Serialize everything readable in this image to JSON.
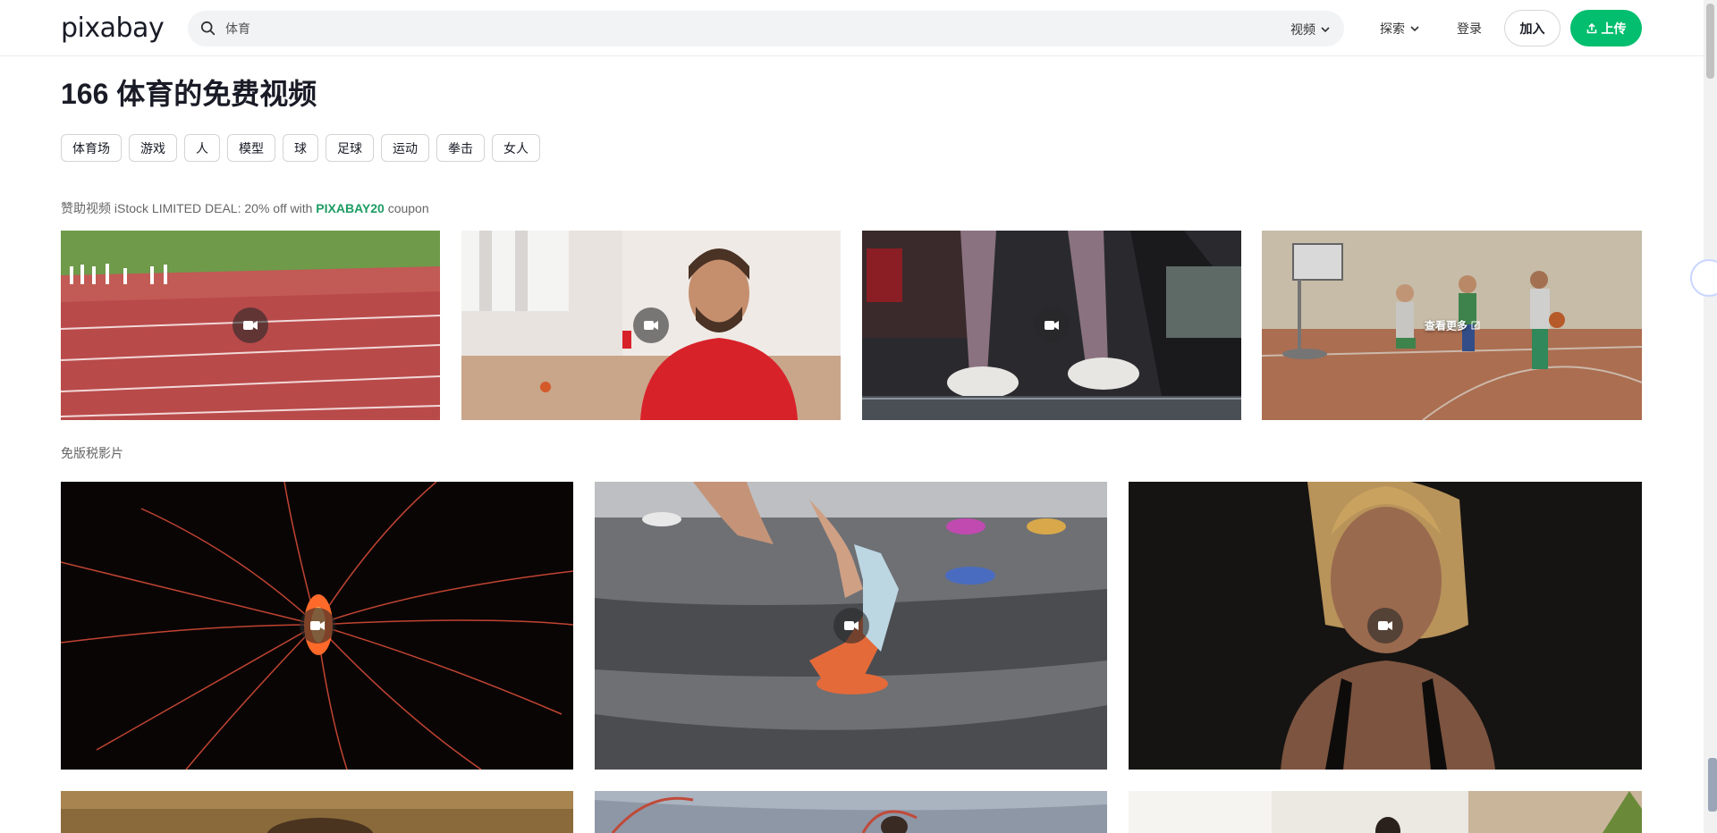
{
  "header": {
    "logo": "pixabay",
    "search_value": "体育",
    "type_select": "视频",
    "explore": "探索",
    "login": "登录",
    "join": "加入",
    "upload": "上传"
  },
  "page_title": "166 体育的免费视频",
  "tags": [
    "体育场",
    "游戏",
    "人",
    "模型",
    "球",
    "足球",
    "运动",
    "拳击",
    "女人"
  ],
  "sponsor": {
    "prefix": "赞助视频 iStock LIMITED DEAL: 20% off with ",
    "code": "PIXABAY20",
    "suffix": " coupon"
  },
  "free_label": "免版税影片",
  "see_more": "查看更多",
  "icons": {
    "search": "search-icon",
    "chevron": "chevron-down-icon",
    "upload": "upload-icon",
    "video": "video-camera-icon",
    "external": "external-link-icon"
  },
  "colors": {
    "accent": "#02be6e",
    "coupon": "#1c9c63"
  }
}
